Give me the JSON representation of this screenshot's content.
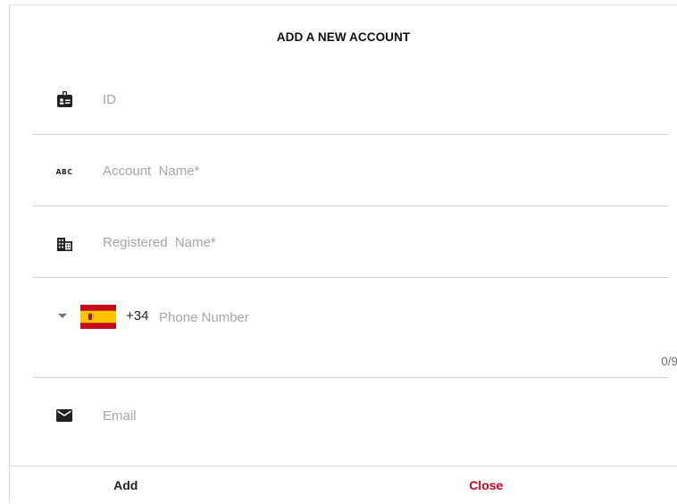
{
  "dialog": {
    "title": "ADD A NEW ACCOUNT"
  },
  "fields": {
    "id": {
      "placeholder": "ID",
      "icon": "badge-icon"
    },
    "account_name": {
      "placeholder": "Account  Name*",
      "icon": "abc-icon",
      "icon_text": "ABC"
    },
    "registered_name": {
      "placeholder": "Registered  Name*",
      "icon": "building-icon"
    },
    "phone": {
      "country_flag": "spain-flag-icon",
      "dial_code": "+34",
      "placeholder": "Phone Number",
      "counter": "0/9"
    },
    "email": {
      "placeholder": "Email",
      "icon": "mail-icon"
    }
  },
  "actions": {
    "add_label": "Add",
    "close_label": "Close"
  },
  "colors": {
    "accent_close": "#d0021b",
    "flag_red": "#c60b1e",
    "flag_yellow": "#ffc400",
    "divider": "#cfcfcf",
    "placeholder": "#a6a6a6"
  }
}
